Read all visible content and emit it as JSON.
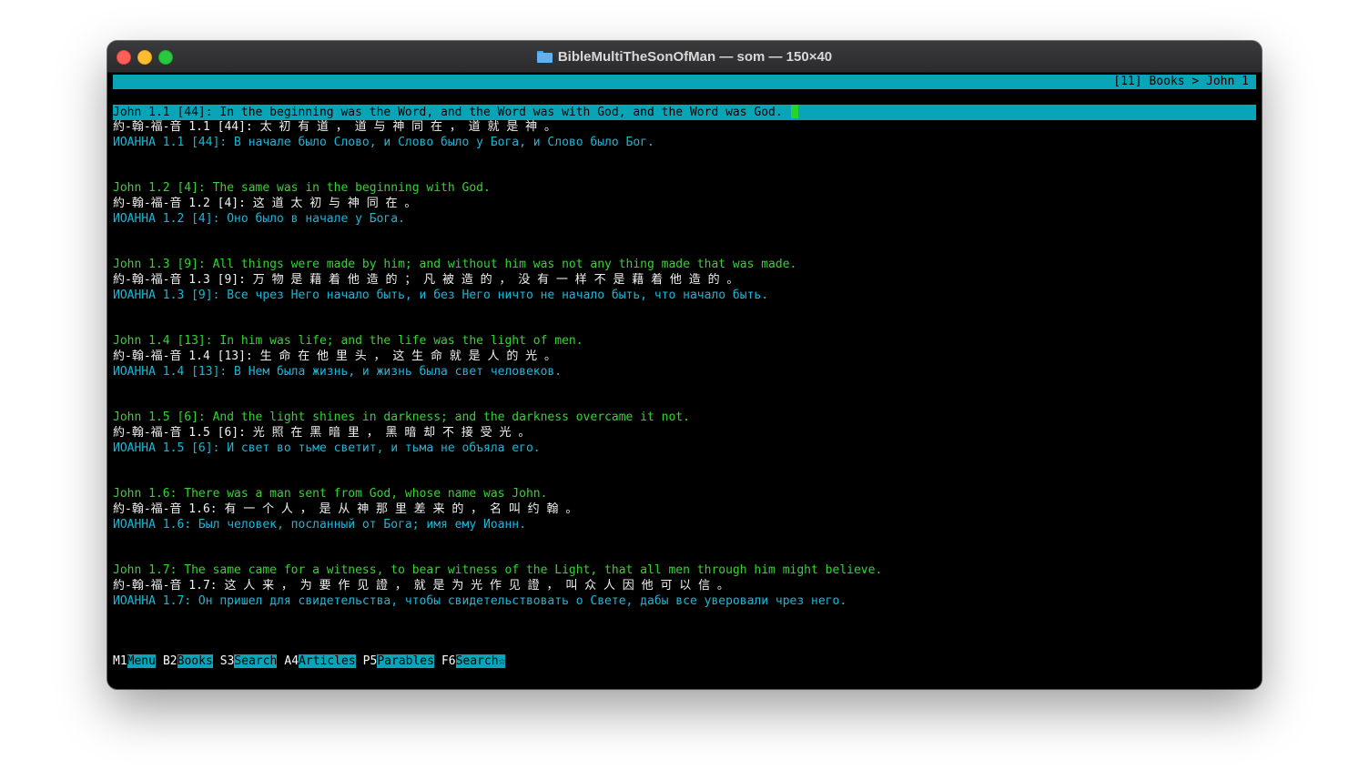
{
  "window": {
    "title": "BibleMultiTheSonOfMan — som — 150×40",
    "folder_icon": "folder-icon"
  },
  "colors": {
    "accent": "#08a5b8",
    "english_text": "#33d433",
    "chinese_text": "#f0f0f0",
    "russian_text": "#19b8d8",
    "background": "#000000"
  },
  "breadcrumb": "[11] Books > John 1",
  "verses": [
    {
      "en": "John 1.1 [44]: In the beginning was the Word, and the Word was with God, and the Word was God.",
      "zh": "約-翰-福-音 1.1 [44]: 太 初 有 道 ， 道 与 神 同 在 ， 道 就 是 神 。",
      "ru": "ИОАННА 1.1 [44]: В начале было Слово, и Слово было у Бога, и Слово было Бог."
    },
    {
      "en": "John 1.2 [4]: The same was in the beginning with God.",
      "zh": "約-翰-福-音 1.2 [4]: 这 道 太 初 与 神 同 在 。",
      "ru": "ИОАННА 1.2 [4]: Оно было в начале у Бога."
    },
    {
      "en": "John 1.3 [9]: All things were made by him; and without him was not any thing made that was made.",
      "zh": "約-翰-福-音 1.3 [9]: 万 物 是 藉 着 他 造 的 ； 凡 被 造 的 ， 没 有 一 样 不 是 藉 着 他 造 的 。",
      "ru": "ИОАННА 1.3 [9]: Все чрез Него начало быть, и без Него ничто не начало быть, что начало быть."
    },
    {
      "en": "John 1.4 [13]: In him was life; and the life was the light of men.",
      "zh": "約-翰-福-音 1.4 [13]: 生 命 在 他 里 头 ， 这 生 命 就 是 人 的 光 。",
      "ru": "ИОАННА 1.4 [13]: В Нем была жизнь, и жизнь была свет человеков."
    },
    {
      "en": "John 1.5 [6]: And the light shines in darkness; and the darkness overcame it not.",
      "zh": "約-翰-福-音 1.5 [6]: 光 照 在 黑 暗 里 ， 黑 暗 却 不 接 受 光 。",
      "ru": "ИОАННА 1.5 [6]: И свет во тьме светит, и тьма не объяла его."
    },
    {
      "en": "John 1.6: There was a man sent from God, whose name was John.",
      "zh": "約-翰-福-音 1.6: 有 一 个 人 ， 是 从 神 那 里 差 来 的 ， 名 叫 约 翰 。",
      "ru": "ИОАННА 1.6: Был человек, посланный от Бога; имя ему Иоанн."
    },
    {
      "en": "John 1.7: The same came for a witness, to bear witness of the Light, that all men through him might believe.",
      "zh": "約-翰-福-音 1.7: 这 人 来 ， 为 要 作 见 證 ， 就 是 为 光 作 见 證 ， 叫 众 人 因 他 可 以 信 。",
      "ru": "ИОАННА 1.7: Он пришел для свидетельства, чтобы свидетельствовать о Свете, дабы все уверовали чрез него."
    }
  ],
  "function_keys": [
    {
      "key": "M1",
      "label": "Menu"
    },
    {
      "key": "B2",
      "label": "Books"
    },
    {
      "key": "S3",
      "label": "Search"
    },
    {
      "key": "A4",
      "label": "Articles"
    },
    {
      "key": "P5",
      "label": "Parables"
    },
    {
      "key": "F6",
      "label": "Search☆"
    }
  ]
}
